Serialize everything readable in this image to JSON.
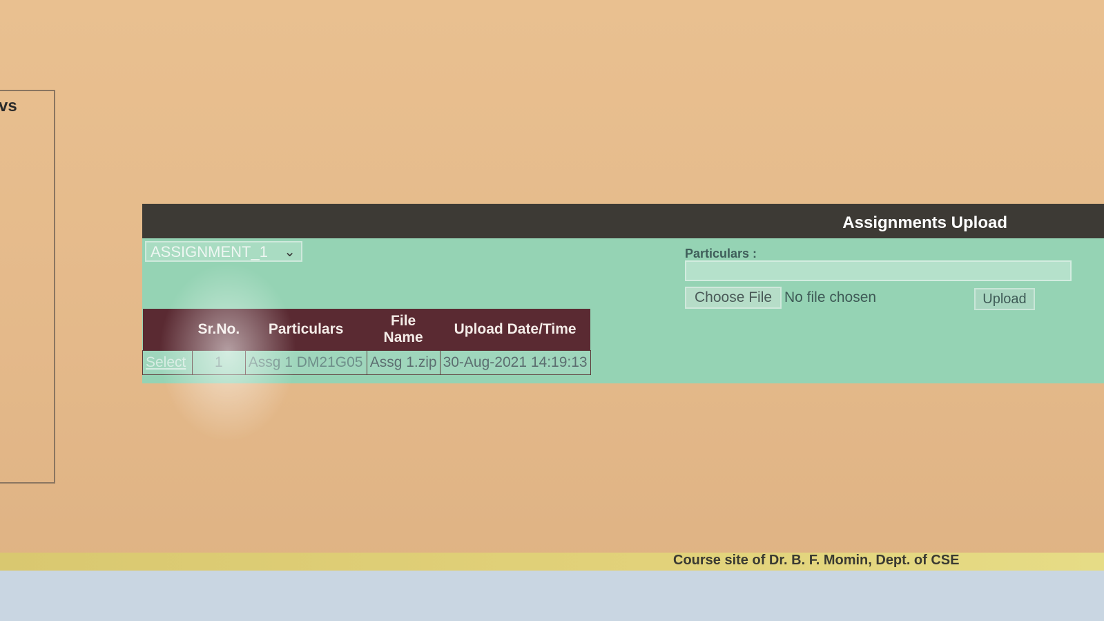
{
  "left_panel": {
    "title_fragment": "vs"
  },
  "panel": {
    "title": "Assignments Upload"
  },
  "assignment_select": {
    "value": "ASSIGNMENT_1"
  },
  "table": {
    "headers": [
      "Sr.No.",
      "Particulars",
      "File Name",
      "Upload Date/Time"
    ],
    "rows": [
      {
        "select_label": "Select",
        "sr_no": "1",
        "particulars": "Assg 1 DM21G05",
        "file_name": "Assg 1.zip",
        "upload_datetime": "30-Aug-2021 14:19:13"
      }
    ]
  },
  "upload_form": {
    "particulars_label": "Particulars :",
    "particulars_value": "",
    "choose_file_label": "Choose File",
    "no_file_text": "No file chosen",
    "upload_label": "Upload"
  },
  "footer": {
    "text": "Course site of Dr. B. F. Momin, Dept. of CSE"
  },
  "icons": {
    "dropdown": "chevron-down-icon"
  }
}
